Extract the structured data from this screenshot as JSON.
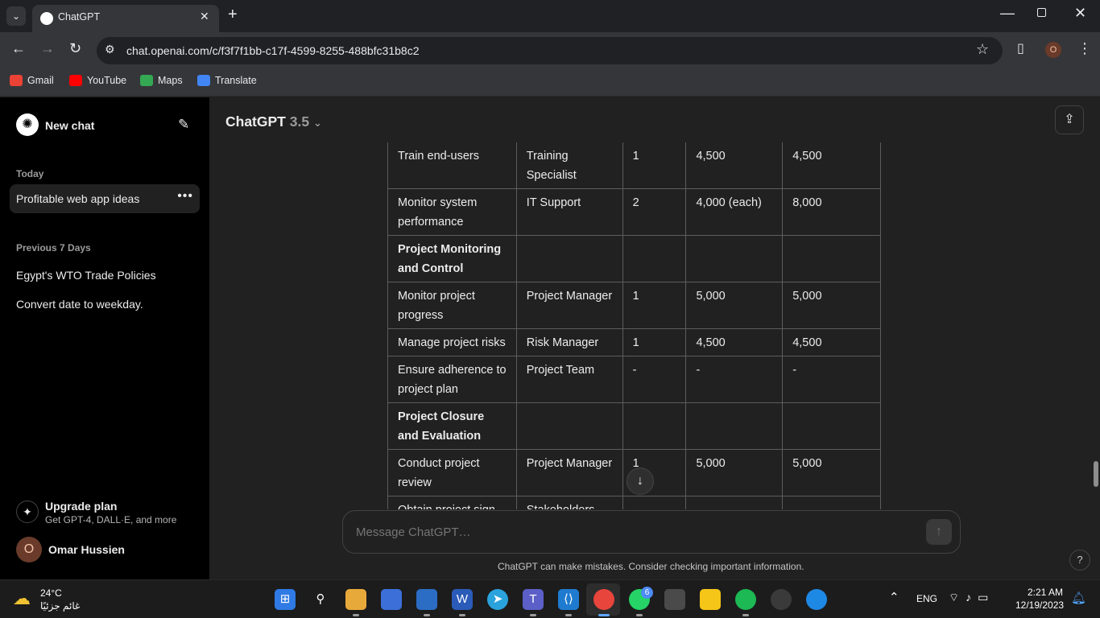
{
  "browser": {
    "tab_title": "ChatGPT",
    "tab_close": "✕",
    "new_tab": "+",
    "url": "chat.openai.com/c/f3f7f1bb-c17f-4599-8255-488bfc31b8c2",
    "profile_initial": "O",
    "bookmarks": [
      {
        "label": "Gmail",
        "color": "#ea4335"
      },
      {
        "label": "YouTube",
        "color": "#ff0000"
      },
      {
        "label": "Maps",
        "color": "#34a853"
      },
      {
        "label": "Translate",
        "color": "#4285f4"
      }
    ]
  },
  "sidebar": {
    "new_chat": "New chat",
    "today_label": "Today",
    "active_item": "Profitable web app ideas",
    "prev_label": "Previous 7 Days",
    "items": [
      "Egypt's WTO Trade Policies",
      "Convert date to weekday."
    ],
    "upgrade_title": "Upgrade plan",
    "upgrade_sub": "Get GPT-4, DALL·E, and more",
    "user_initial": "O",
    "user_name": "Omar Hussien"
  },
  "main": {
    "model_name": "ChatGPT",
    "model_version": "3.5",
    "table_rows": [
      [
        "Train end-users",
        "Training Specialist",
        "1",
        "4,500",
        "4,500"
      ],
      [
        "Monitor system performance",
        "IT Support",
        "2",
        "4,000 (each)",
        "8,000"
      ],
      [
        "Project Monitoring and Control",
        "",
        "",
        "",
        ""
      ],
      [
        "Monitor project progress",
        "Project Manager",
        "1",
        "5,000",
        "5,000"
      ],
      [
        "Manage project risks",
        "Risk Manager",
        "1",
        "4,500",
        "4,500"
      ],
      [
        "Ensure adherence to project plan",
        "Project Team",
        "-",
        "-",
        "-"
      ],
      [
        "Project Closure and Evaluation",
        "",
        "",
        "",
        ""
      ],
      [
        "Conduct project review",
        "Project Manager",
        "1",
        "5,000",
        "5,000"
      ],
      [
        "Obtain project sign-",
        "Stakeholders",
        "-",
        "-",
        "-"
      ]
    ],
    "bold_rows": [
      2,
      6
    ],
    "composer_placeholder": "Message ChatGPT…",
    "disclaimer": "ChatGPT can make mistakes. Consider checking important information.",
    "help": "?"
  },
  "taskbar": {
    "temperature": "24°C",
    "weather_desc": "غائم جزئيًا",
    "whatsapp_badge": "6",
    "language": "ENG",
    "time": "2:21 AM",
    "date": "12/19/2023"
  },
  "colors": {
    "sidebar_bg": "#000000",
    "main_bg": "#212121",
    "chrome_bg": "#35363a"
  }
}
